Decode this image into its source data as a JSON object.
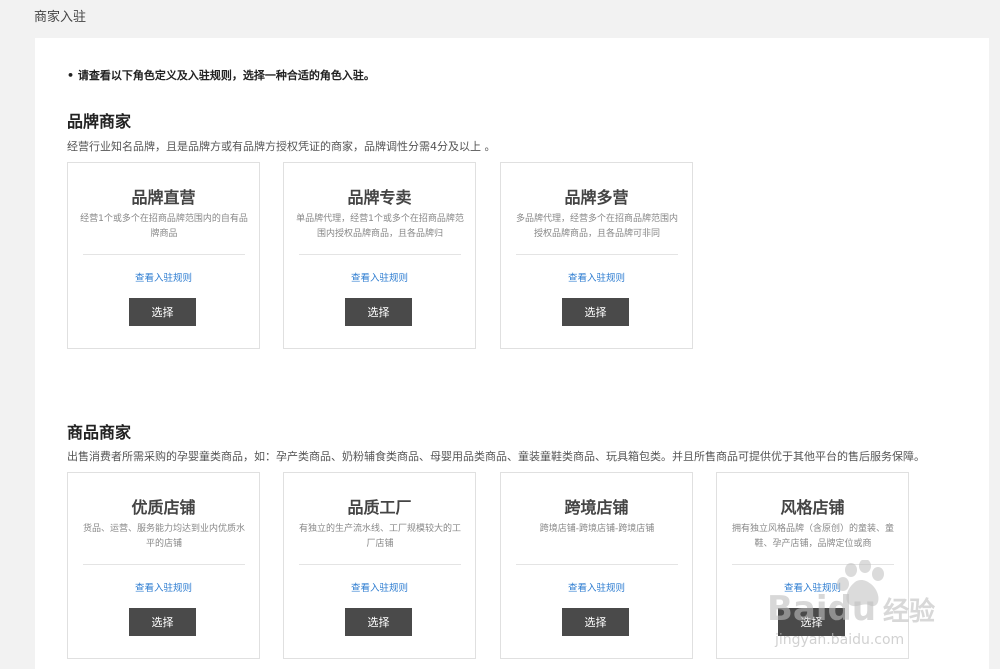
{
  "header": {
    "title": "商家入驻"
  },
  "notice": "• 请查看以下角色定义及入驻规则，选择一种合适的角色入驻。",
  "sections": [
    {
      "title": "品牌商家",
      "desc": "经营行业知名品牌，且是品牌方或有品牌方授权凭证的商家，品牌调性分需4分及以上 。",
      "cards": [
        {
          "title": "品牌直营",
          "desc": "经营1个或多个在招商品牌范围内的自有品牌商品",
          "link": "查看入驻规则",
          "button": "选择"
        },
        {
          "title": "品牌专卖",
          "desc": "单品牌代理，经营1个或多个在招商品牌范围内授权品牌商品，且各品牌归",
          "link": "查看入驻规则",
          "button": "选择"
        },
        {
          "title": "品牌多营",
          "desc": "多品牌代理，经营多个在招商品牌范围内授权品牌商品，且各品牌可非同",
          "link": "查看入驻规则",
          "button": "选择"
        }
      ]
    },
    {
      "title": "商品商家",
      "desc": "出售消费者所需采购的孕婴童类商品，如：孕产类商品、奶粉辅食类商品、母婴用品类商品、童装童鞋类商品、玩具箱包类。并且所售商品可提供优于其他平台的售后服务保障。",
      "cards": [
        {
          "title": "优质店铺",
          "desc": "货品、运营、服务能力均达到业内优质水平的店铺",
          "link": "查看入驻规则",
          "button": "选择"
        },
        {
          "title": "品质工厂",
          "desc": "有独立的生产流水线、工厂规模较大的工厂店铺",
          "link": "查看入驻规则",
          "button": "选择"
        },
        {
          "title": "跨境店铺",
          "desc": "跨境店铺-跨境店铺-跨境店铺",
          "link": "查看入驻规则",
          "button": "选择"
        },
        {
          "title": "风格店铺",
          "desc": "拥有独立风格品牌（含原创）的童装、童鞋、孕产店铺，品牌定位或商",
          "link": "查看入驻规则",
          "button": "选择"
        }
      ]
    }
  ],
  "watermark": {
    "brand": "Baidu",
    "brand_cn": "经验",
    "url": "jingyan.baidu.com"
  }
}
